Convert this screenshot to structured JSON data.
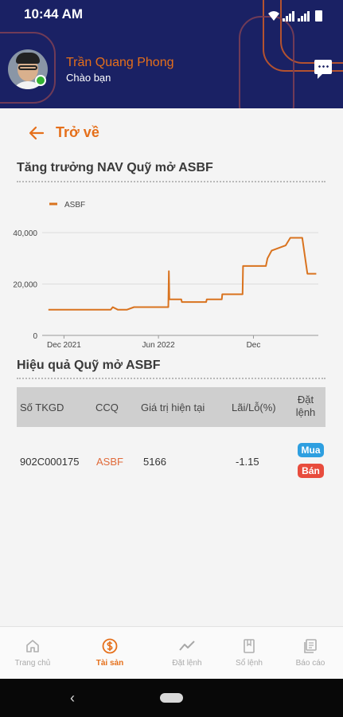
{
  "status_bar": {
    "time": "10:44 AM"
  },
  "header": {
    "user_name": "Trần Quang Phong",
    "greeting": "Chào bạn"
  },
  "back": {
    "label": "Trở về"
  },
  "nav_section": {
    "title": "Tăng trưởng NAV Quỹ mở ASBF"
  },
  "chart_data": {
    "type": "line",
    "title": "",
    "xlabel": "",
    "ylabel": "",
    "legend": "top-left",
    "grid": "horizontal",
    "ylim": [
      0,
      40000
    ],
    "y_ticks": [
      "0",
      "20,000",
      "40,000"
    ],
    "x_ticks": [
      "Dec 2021",
      "Jun 2022",
      "Dec"
    ],
    "series": [
      {
        "name": "ASBF",
        "color": "#d9731f",
        "points": [
          [
            "2021-11-01",
            10000
          ],
          [
            "2022-01-01",
            10000
          ],
          [
            "2022-03-01",
            10000
          ],
          [
            "2022-03-05",
            11000
          ],
          [
            "2022-03-15",
            10000
          ],
          [
            "2022-04-01",
            10000
          ],
          [
            "2022-04-15",
            11000
          ],
          [
            "2022-06-20",
            11000
          ],
          [
            "2022-06-21",
            25000
          ],
          [
            "2022-06-22",
            14000
          ],
          [
            "2022-07-15",
            14000
          ],
          [
            "2022-07-16",
            13000
          ],
          [
            "2022-09-01",
            13000
          ],
          [
            "2022-09-02",
            14000
          ],
          [
            "2022-10-01",
            14000
          ],
          [
            "2022-10-02",
            16000
          ],
          [
            "2022-11-10",
            16000
          ],
          [
            "2022-11-11",
            27000
          ],
          [
            "2022-12-25",
            27000
          ],
          [
            "2022-12-28",
            30000
          ],
          [
            "2023-01-05",
            33000
          ],
          [
            "2023-02-01",
            35000
          ],
          [
            "2023-02-10",
            38000
          ],
          [
            "2023-03-05",
            38000
          ],
          [
            "2023-03-15",
            24000
          ],
          [
            "2023-04-01",
            24000
          ]
        ]
      }
    ]
  },
  "perf_section": {
    "title": "Hiệu quả Quỹ mở ASBF"
  },
  "table": {
    "headers": [
      "Số TKGD",
      "CCQ",
      "Giá trị hiện tại",
      "Lãi/Lỗ(%)",
      "Đặt lệnh"
    ],
    "rows": [
      {
        "account": "902C000175",
        "fund": "ASBF",
        "value": "5166",
        "pnl": "-1.15",
        "buy": "Mua",
        "sell": "Bán"
      }
    ]
  },
  "bottom_nav": {
    "items": [
      {
        "label": "Trang chủ",
        "icon": "home-icon"
      },
      {
        "label": "Tài sản",
        "icon": "dollar-icon"
      },
      {
        "label": "Đặt lệnh",
        "icon": "trend-icon"
      },
      {
        "label": "Sổ lệnh",
        "icon": "book-icon"
      },
      {
        "label": "Báo cáo",
        "icon": "report-icon"
      }
    ],
    "active_index": 1
  },
  "colors": {
    "header_bg": "#1a2164",
    "accent": "#e56f1a",
    "buy": "#2e9fe0",
    "sell": "#e84c3d"
  }
}
